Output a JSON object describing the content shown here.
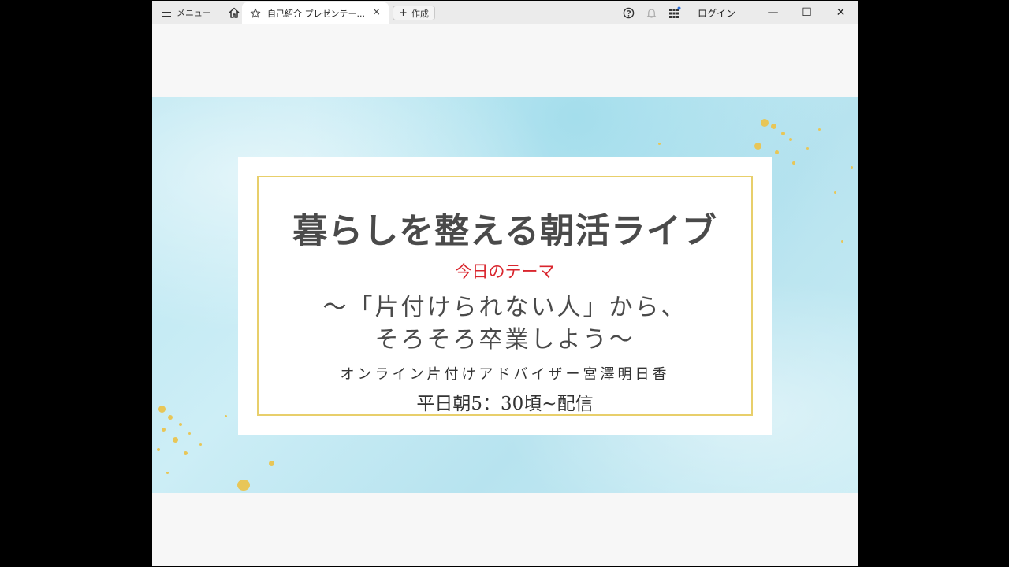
{
  "toolbar": {
    "menu_label": "メニュー",
    "tab_title": "自己紹介 プレゼンテー...",
    "tab_close": "×",
    "create_label": "作成",
    "login_label": "ログイン"
  },
  "window_controls": {
    "minimize": "—",
    "maximize": "☐",
    "close": "✕"
  },
  "icons": {
    "menu": "hamburger-icon",
    "home": "home-icon",
    "favorite": "star-icon",
    "help": "help-icon",
    "notifications": "bell-icon",
    "apps": "apps-grid-icon"
  },
  "slide": {
    "title": "暮らしを整える朝活ライブ",
    "theme_label": "今日のテーマ",
    "theme_line1": "～「片付けられない人」から、",
    "theme_line2": "そろそろ卒業しよう～",
    "presenter": "オンライン片付けアドバイザー宮澤明日香",
    "schedule": "平日朝5：30頃~配信"
  },
  "colors": {
    "accent_red": "#d9262e",
    "frame_gold": "#e8cf6b",
    "background_blue": "#b9e6f1",
    "title_gray": "#4a4a4a"
  }
}
